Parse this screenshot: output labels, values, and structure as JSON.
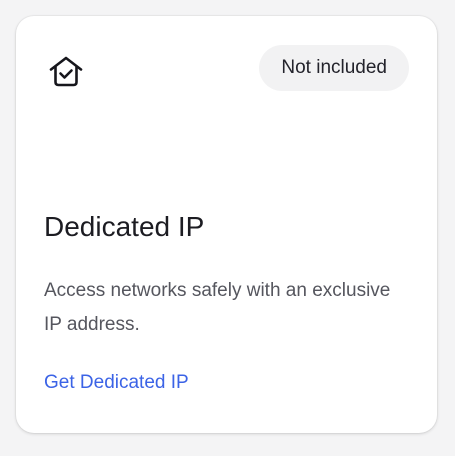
{
  "card": {
    "icon": "home-check-icon",
    "badge_label": "Not included",
    "title": "Dedicated IP",
    "description": "Access networks safely with an exclusive IP address.",
    "cta_label": "Get Dedicated IP"
  },
  "colors": {
    "accent": "#3b63e6",
    "badge_background": "#f2f2f3",
    "title_text": "#1c1c22",
    "body_text": "#55565e"
  }
}
